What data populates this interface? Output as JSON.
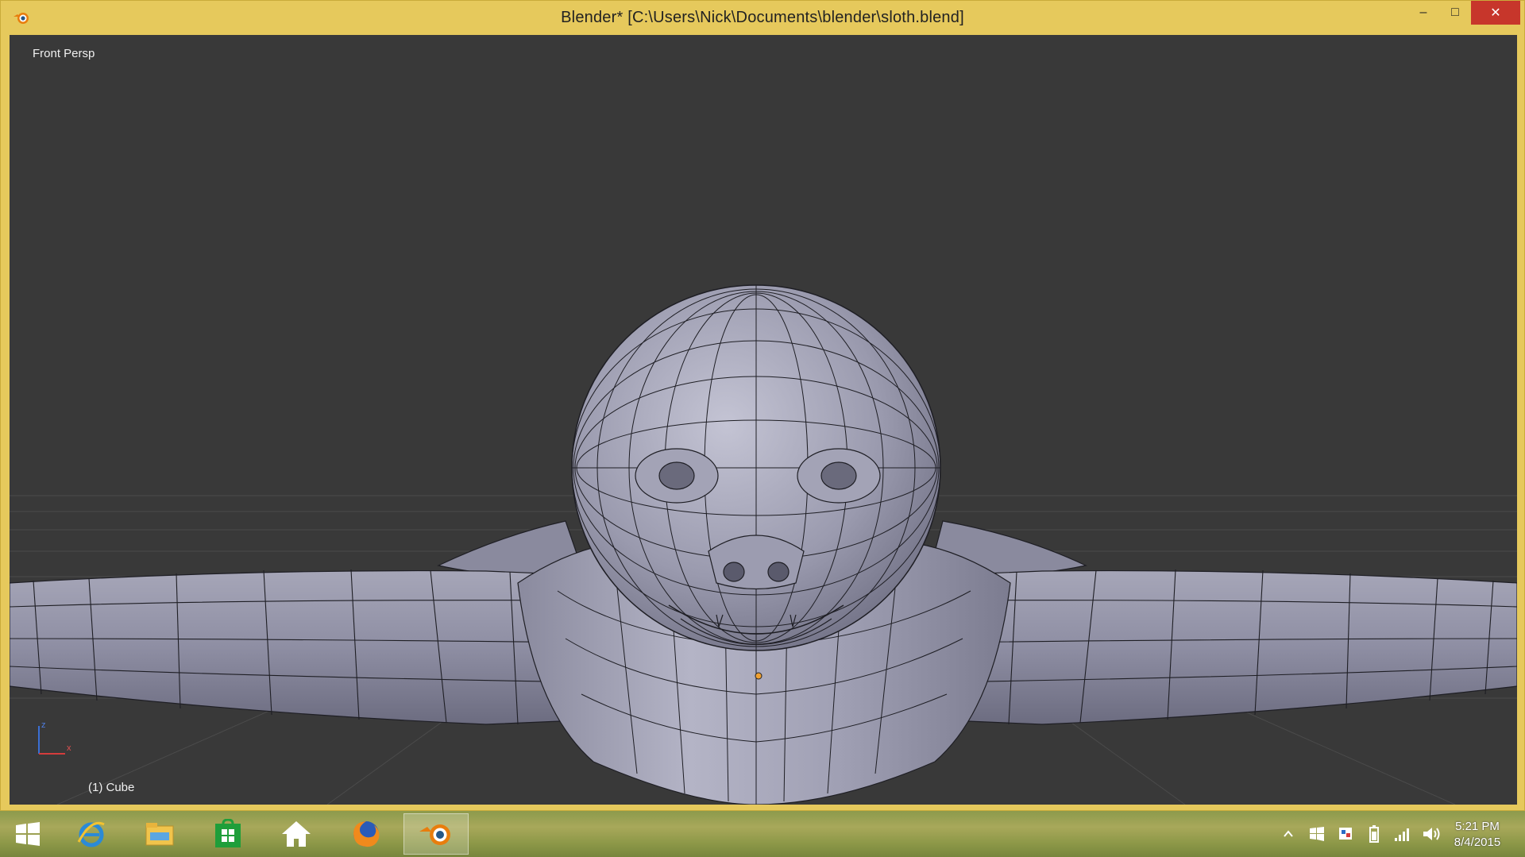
{
  "window": {
    "title": "Blender* [C:\\Users\\Nick\\Documents\\blender\\sloth.blend]",
    "controls": {
      "minimize": "‒",
      "maximize": "□",
      "close": "✕"
    }
  },
  "viewport": {
    "view_name": "Front Persp",
    "active_object": "(1) Cube",
    "axis_labels": {
      "z": "z",
      "x": "x"
    }
  },
  "taskbar": {
    "apps": [
      {
        "name": "start-button"
      },
      {
        "name": "internet-explorer"
      },
      {
        "name": "file-explorer"
      },
      {
        "name": "windows-store"
      },
      {
        "name": "home"
      },
      {
        "name": "firefox"
      },
      {
        "name": "blender",
        "active": true
      }
    ],
    "clock": {
      "time": "5:21 PM",
      "date": "8/4/2015"
    }
  },
  "colors": {
    "frame": "#e6c95c",
    "viewport_bg": "#393939",
    "mesh_fill": "#8e8ea3",
    "mesh_wire": "#1e1e24",
    "close_button": "#c7362b"
  }
}
